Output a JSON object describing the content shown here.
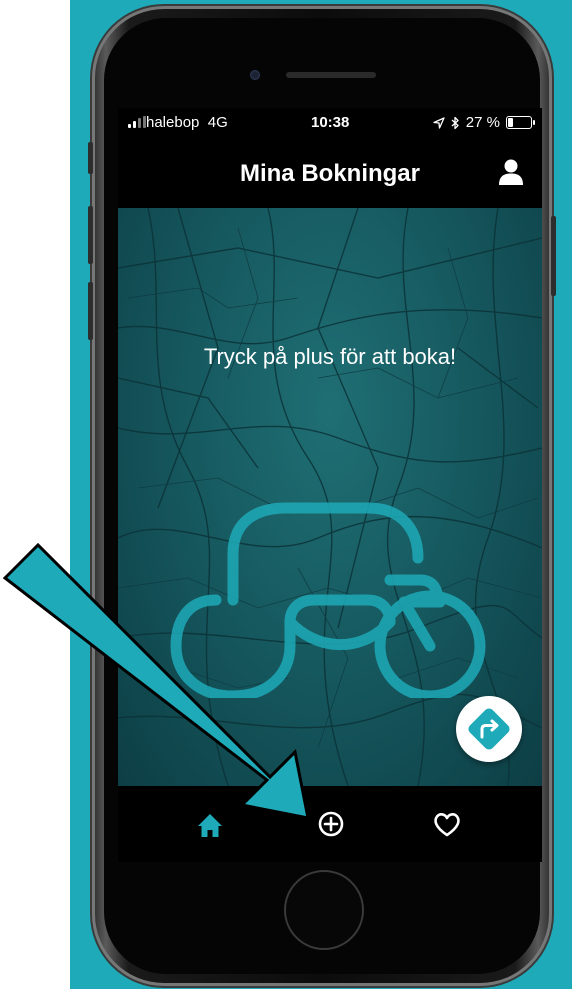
{
  "status_bar": {
    "carrier": "halebop",
    "network": "4G",
    "time": "10:38",
    "battery_text": "27 %",
    "battery_level": 0.27
  },
  "header": {
    "title": "Mina Bokningar",
    "profile_icon": "person-icon"
  },
  "main": {
    "empty_message": "Tryck på plus för att boka!",
    "fab_icon": "directions-icon"
  },
  "tabs": [
    {
      "name": "home",
      "icon": "home-icon",
      "active": true
    },
    {
      "name": "add",
      "icon": "plus-circle-icon",
      "active": false
    },
    {
      "name": "favorites",
      "icon": "heart-icon",
      "active": false
    }
  ],
  "colors": {
    "background": "#1eaab8",
    "accent": "#1eaab8",
    "header_bg": "#000000",
    "map_bg": "#165a60"
  }
}
